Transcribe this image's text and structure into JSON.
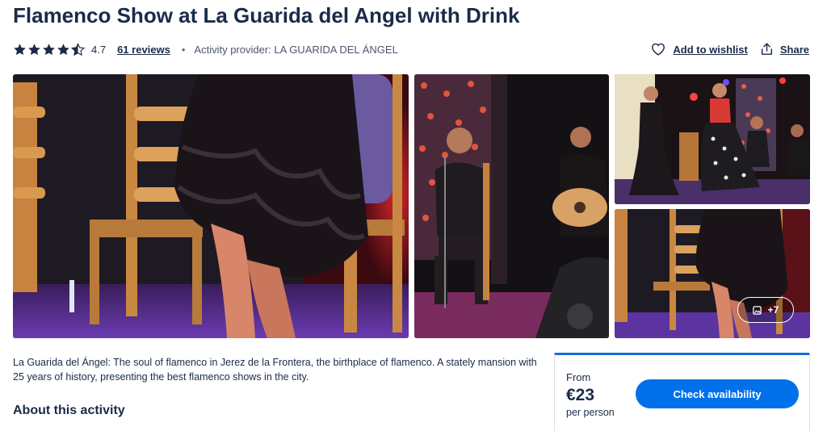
{
  "activity": {
    "title": "Flamenco Show at La Guarida del Angel with Drink",
    "rating": "4.7",
    "reviews": "61 reviews",
    "separator": "•",
    "provider": "Activity provider: LA GUARIDA DEL ÁNGEL",
    "stars": {
      "value": 4.7,
      "max": 5,
      "color": "#1a2b49"
    }
  },
  "actions": {
    "wishlist": {
      "label": "Add to wishlist",
      "icon": "heart-icon"
    },
    "share": {
      "label": "Share",
      "icon": "share-icon"
    }
  },
  "gallery": {
    "more_label": "+7",
    "more_icon": "image-icon"
  },
  "description": "La Guarida del Ángel: The soul of flamenco in Jerez de la Frontera, the birthplace of flamenco. A stately mansion with 25 years of history, presenting the best flamenco shows in the city.",
  "about": {
    "heading": "About this activity"
  },
  "booking": {
    "from_label": "From",
    "price": "€23",
    "per_label": "per person",
    "button_label": "Check availability"
  },
  "colors": {
    "text": "#1a2b49",
    "accent": "#0071eb",
    "card_top": "#1a6cd3"
  }
}
